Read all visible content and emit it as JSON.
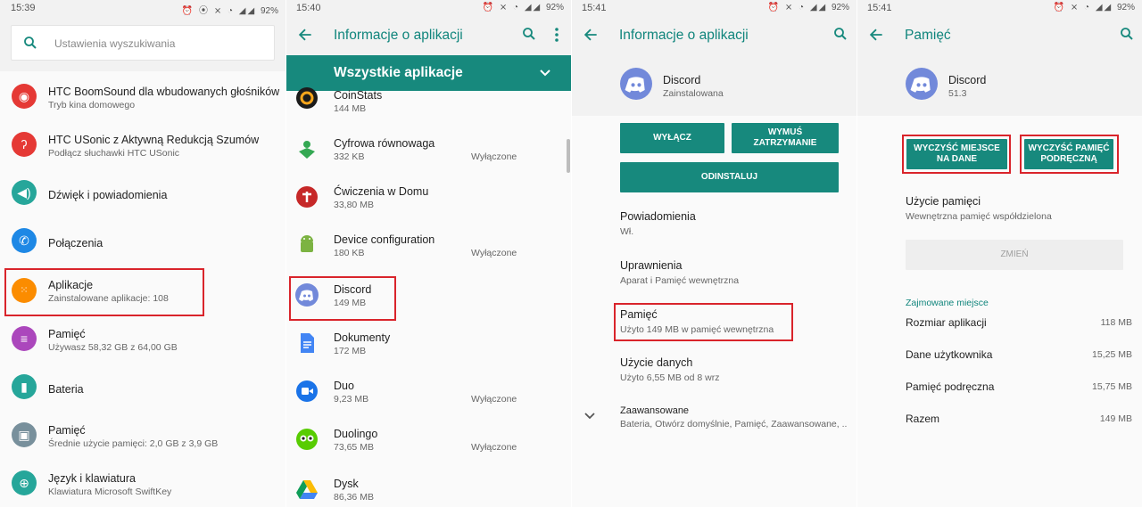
{
  "colors": {
    "accent": "#17897d",
    "accent_text": "#10857c",
    "highlight": "#d9242b"
  },
  "panels": [
    {
      "status": {
        "time": "15:39",
        "battery": "92%"
      },
      "search": {
        "placeholder": "Ustawienia wyszukiwania",
        "icon": "search-icon"
      },
      "items": [
        {
          "title": "HTC BoomSound dla wbudowanych głośników",
          "subtitle": "Tryb kina domowego",
          "icon": "boomsound-icon",
          "color": "#e53935"
        },
        {
          "title": "HTC USonic z Aktywną Redukcją Szumów",
          "subtitle": "Podłącz słuchawki HTC USonic",
          "icon": "ear-icon",
          "color": "#e53935"
        },
        {
          "title": "Dźwięk i powiadomienia",
          "subtitle": "",
          "icon": "volume-icon",
          "color": "#26a69a"
        },
        {
          "title": "Połączenia",
          "subtitle": "",
          "icon": "phone-icon",
          "color": "#1e88e5"
        },
        {
          "title": "Aplikacje",
          "subtitle": "Zainstalowane aplikacje: 108",
          "icon": "apps-grid-icon",
          "color": "#fb8c00"
        },
        {
          "title": "Pamięć",
          "subtitle": "Używasz 58,32 GB z 64,00 GB",
          "icon": "storage-icon",
          "color": "#ab47bc"
        },
        {
          "title": "Bateria",
          "subtitle": "",
          "icon": "battery-icon",
          "color": "#26a69a"
        },
        {
          "title": "Pamięć",
          "subtitle": "Średnie użycie pamięci: 2,0 GB z 3,9 GB",
          "icon": "memory-chip-icon",
          "color": "#78909c"
        },
        {
          "title": "Język i klawiatura",
          "subtitle": "Klawiatura Microsoft SwiftKey",
          "icon": "globe-icon",
          "color": "#26a69a"
        }
      ]
    },
    {
      "status": {
        "time": "15:40",
        "battery": "92%"
      },
      "title": "Informacje o aplikacji",
      "filter": "Wszystkie aplikacje",
      "apps": [
        {
          "name": "CoinStats",
          "size": "144 MB",
          "state": ""
        },
        {
          "name": "Cyfrowa równowaga",
          "size": "332 KB",
          "state": "Wyłączone"
        },
        {
          "name": "Ćwiczenia w Domu",
          "size": "33,80 MB",
          "state": ""
        },
        {
          "name": "Device configuration",
          "size": "180 KB",
          "state": "Wyłączone"
        },
        {
          "name": "Discord",
          "size": "149 MB",
          "state": ""
        },
        {
          "name": "Dokumenty",
          "size": "172 MB",
          "state": ""
        },
        {
          "name": "Duo",
          "size": "9,23 MB",
          "state": "Wyłączone"
        },
        {
          "name": "Duolingo",
          "size": "73,65 MB",
          "state": "Wyłączone"
        },
        {
          "name": "Dysk",
          "size": "86,36 MB",
          "state": ""
        }
      ]
    },
    {
      "status": {
        "time": "15:41",
        "battery": "92%"
      },
      "title": "Informacje o aplikacji",
      "app": {
        "name": "Discord",
        "status": "Zainstalowana"
      },
      "buttons": {
        "disable": "WYŁĄCZ",
        "force_stop": "WYMUŚ ZATRZYMANIE",
        "uninstall": "ODINSTALUJ"
      },
      "rows": [
        {
          "title": "Powiadomienia",
          "subtitle": "Wł."
        },
        {
          "title": "Uprawnienia",
          "subtitle": "Aparat i Pamięć wewnętrzna"
        },
        {
          "title": "Pamięć",
          "subtitle": "Użyto 149 MB w pamięć wewnętrzna"
        },
        {
          "title": "Użycie danych",
          "subtitle": "Użyto 6,55 MB od 8 wrz"
        },
        {
          "title": "Zaawansowane",
          "subtitle": "Bateria, Otwórz domyślnie, Pamięć, Zaawansowane, .."
        }
      ]
    },
    {
      "status": {
        "time": "15:41",
        "battery": "92%"
      },
      "title": "Pamięć",
      "app": {
        "name": "Discord",
        "version": "51.3"
      },
      "buttons": {
        "clear_data": "WYCZYŚĆ MIEJSCE NA DANE",
        "clear_cache": "WYCZYŚĆ PAMIĘĆ PODRĘCZNĄ",
        "change": "ZMIEŃ"
      },
      "usage": {
        "title": "Użycie pamięci",
        "subtitle": "Wewnętrzna pamięć współdzielona"
      },
      "section": "Zajmowane miejsce",
      "stats": [
        {
          "label": "Rozmiar aplikacji",
          "value": "118 MB"
        },
        {
          "label": "Dane użytkownika",
          "value": "15,25 MB"
        },
        {
          "label": "Pamięć podręczna",
          "value": "15,75 MB"
        },
        {
          "label": "Razem",
          "value": "149 MB"
        }
      ]
    }
  ]
}
